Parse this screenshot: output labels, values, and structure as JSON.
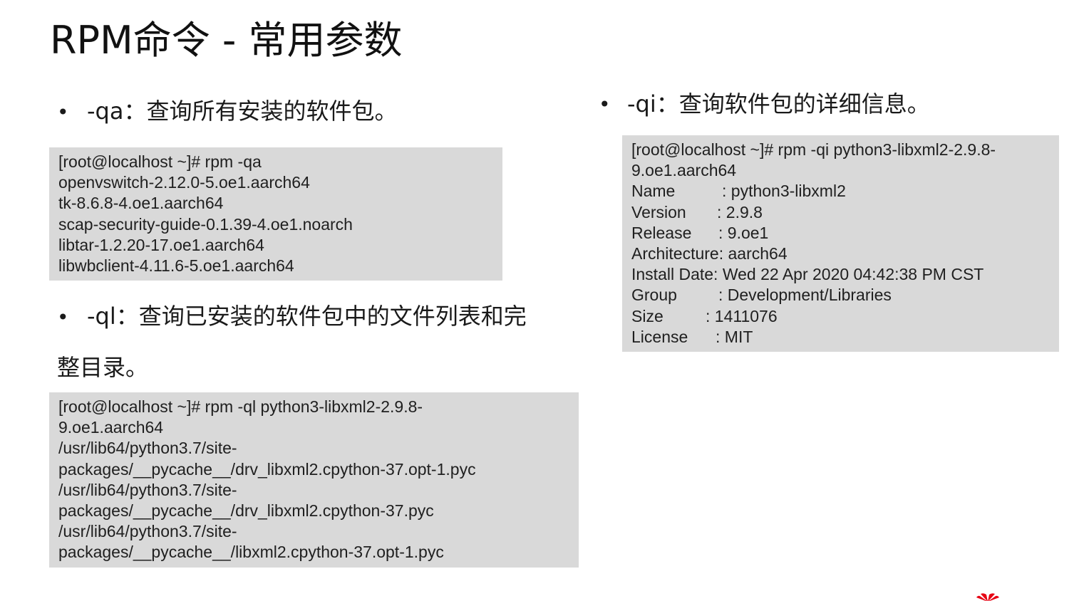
{
  "title": "RPM命令 - 常用参数",
  "left_column": {
    "qa": {
      "bullet": "•",
      "label": "-qa：查询所有安装的软件包。",
      "code_lines": [
        "[root@localhost ~]# rpm -qa",
        "openvswitch-2.12.0-5.oe1.aarch64",
        "tk-8.6.8-4.oe1.aarch64",
        "scap-security-guide-0.1.39-4.oe1.noarch",
        "libtar-1.2.20-17.oe1.aarch64",
        "libwbclient-4.11.6-5.oe1.aarch64"
      ]
    },
    "ql": {
      "bullet": "•",
      "label_line1": "-ql：查询已安装的软件包中的文件列表和完",
      "label_line2": "整目录。",
      "code_lines": [
        "[root@localhost ~]# rpm -ql python3-libxml2-2.9.8-",
        "9.oe1.aarch64",
        "/usr/lib64/python3.7/site-",
        "packages/__pycache__/drv_libxml2.cpython-37.opt-1.pyc",
        "/usr/lib64/python3.7/site-",
        "packages/__pycache__/drv_libxml2.cpython-37.pyc",
        "/usr/lib64/python3.7/site-",
        "packages/__pycache__/libxml2.cpython-37.opt-1.pyc"
      ]
    }
  },
  "right_column": {
    "qi": {
      "bullet": "•",
      "label": "-qi：查询软件包的详细信息。",
      "command_line1": "[root@localhost ~]# rpm -qi python3-libxml2-2.9.8-",
      "command_line2": "9.oe1.aarch64",
      "fields": [
        {
          "key": "Name",
          "value": ": python3-libxml2"
        },
        {
          "key": "Version",
          "value": ": 2.9.8"
        },
        {
          "key": "Release",
          "value": ": 9.oe1"
        },
        {
          "key": "Architecture:",
          "value": " aarch64"
        },
        {
          "key": "Install Date:",
          "value": " Wed 22 Apr 2020 04:42:38 PM CST"
        },
        {
          "key": "Group",
          "value": ": Development/Libraries"
        },
        {
          "key": "Size",
          "value": ": 1411076"
        },
        {
          "key": "License",
          "value": ": MIT"
        }
      ]
    }
  },
  "colors": {
    "code_background": "#d9d9d9",
    "text": "#1a1a1a",
    "logo_red": "#e60012"
  },
  "icons": {
    "brand_logo": "huawei-logo-icon"
  }
}
